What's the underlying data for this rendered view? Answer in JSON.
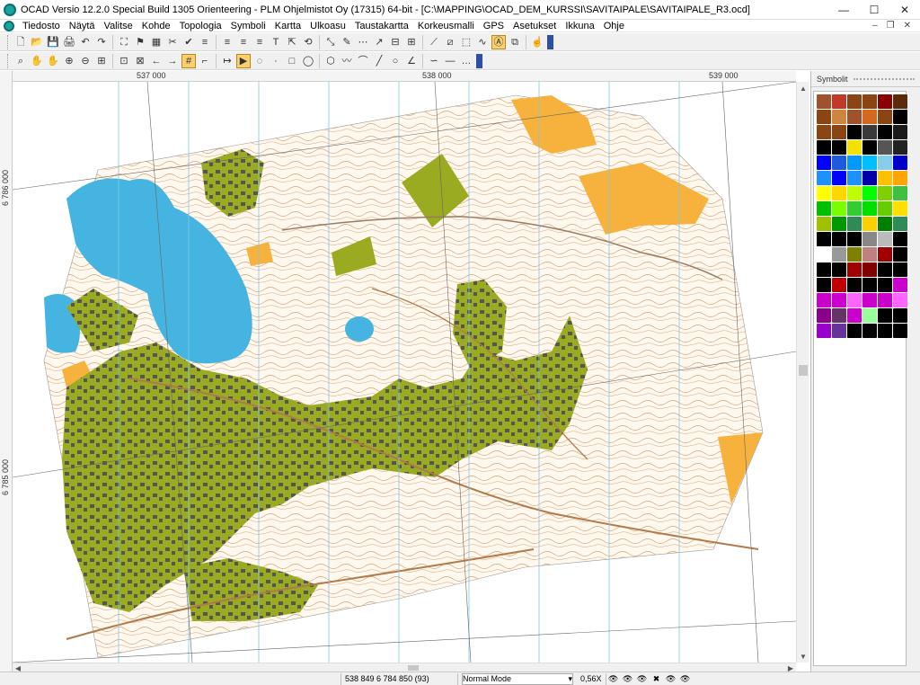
{
  "window": {
    "title": "OCAD Versio 12.2.0  Special Build 1305  Orienteering - PLM Ohjelmistot Oy (17315) 64-bit - [C:\\MAPPING\\OCAD_DEM_KURSSI\\SAVITAIPALE\\SAVITAIPALE_R3.ocd]",
    "minimize": "—",
    "maximize": "☐",
    "close": "✕"
  },
  "menu": {
    "items": [
      "Tiedosto",
      "Näytä",
      "Valitse",
      "Kohde",
      "Topologia",
      "Symboli",
      "Kartta",
      "Ulkoasu",
      "Taustakartta",
      "Korkeusmalli",
      "GPS",
      "Asetukset",
      "Ikkuna",
      "Ohje"
    ],
    "doc_min": "–",
    "doc_restore": "❐",
    "doc_close": "✕"
  },
  "toolbar1": {
    "icons": [
      "new-icon",
      "open-icon",
      "save-icon",
      "print-icon",
      "undo-icon",
      "redo-icon",
      "fit-icon",
      "help-icon",
      "color-icon",
      "cut-icon",
      "check-icon",
      "align-left-icon",
      "align-center-icon",
      "align-right-icon",
      "justify-icon",
      "text-icon",
      "move-icon",
      "rotate-icon",
      "scale-icon",
      "measure-icon",
      "reshape-icon",
      "edit-icon",
      "ruler-icon",
      "crop-icon",
      "cut-line-icon",
      "cut-area-icon",
      "merge-icon",
      "smooth-icon",
      "draw-mode-icon",
      "overlap-icon",
      "hand-icon"
    ],
    "glyphs": [
      "🗋",
      "📂",
      "💾",
      "🖨",
      "↶",
      "↷",
      "⛶",
      "⚑",
      "▦",
      "✂",
      "✔",
      "≡",
      "≡",
      "≡",
      "≡",
      "T",
      "⇱",
      "⟲",
      "⤡",
      "✎",
      "⋯",
      "↗",
      "⊟",
      "⊞",
      "⟋",
      "⧄",
      "⬚",
      "∿",
      "Ⓐ",
      "⧉",
      "☝"
    ]
  },
  "toolbar2": {
    "icons": [
      "binoculars-icon",
      "pan-icon",
      "hand-icon",
      "zoom-in-icon",
      "zoom-out-icon",
      "zoom-box-icon",
      "zoom-fit-icon",
      "zoom-page-icon",
      "back-icon",
      "forward-icon",
      "grid-icon",
      "snap-icon",
      "draw-arrow-icon",
      "select-icon",
      "lasso-icon",
      "point-icon",
      "rect-icon",
      "ellipse-icon",
      "polygon-icon",
      "freehand-icon",
      "curve-icon",
      "straight-icon",
      "circle-icon",
      "angle-icon",
      "spline-icon",
      "line-icon",
      "more-icon"
    ],
    "glyphs": [
      "⌕",
      "✋",
      "✋",
      "⊕",
      "⊖",
      "⊞",
      "⊡",
      "⊠",
      "←",
      "→",
      "#",
      "⌐",
      "↦",
      "▶",
      "◌",
      "·",
      "□",
      "◯",
      "⬡",
      "〰",
      "⌒",
      "╱",
      "○",
      "∠",
      "∽",
      "—",
      "…"
    ]
  },
  "rulers": {
    "top": [
      "537 000",
      "538 000",
      "539 000"
    ],
    "left": [
      "6 786 000",
      "6 785 000"
    ]
  },
  "symbols_panel": {
    "title": "Symbolit",
    "swatches": [
      "#a0522d",
      "#c0392b",
      "#8b4513",
      "#8b4513",
      "#8b0000",
      "#5a2a0a",
      "#8b4513",
      "#cd853f",
      "#a0522d",
      "#d2691e",
      "#8b4513",
      "#000000",
      "#8b4513",
      "#8b4513",
      "#000000",
      "#3a3a3a",
      "#000000",
      "#1a1a1a",
      "#000000",
      "#000000",
      "#f4e100",
      "#000000",
      "#555555",
      "#222222",
      "#0000ff",
      "#1e5adc",
      "#0099ff",
      "#00bfff",
      "#87ceeb",
      "#0000cd",
      "#1e90ff",
      "#0000ff",
      "#1e90ff",
      "#0000aa",
      "#ffc000",
      "#ffa500",
      "#ffff00",
      "#ffd700",
      "#c0ff00",
      "#00ff00",
      "#7fd000",
      "#40c040",
      "#00c000",
      "#7cfc00",
      "#33cc33",
      "#00e000",
      "#66cc00",
      "#ffe000",
      "#a0c000",
      "#009900",
      "#2e8b57",
      "#ffd000",
      "#008000",
      "#2e8b57",
      "#000000",
      "#000000",
      "#000000",
      "#888888",
      "#bbbbbb",
      "#000000",
      "#ffffff",
      "#999999",
      "#7f7f00",
      "#c08080",
      "#a00000",
      "#000000",
      "#000000",
      "#000000",
      "#a00000",
      "#800000",
      "#000000",
      "#000000",
      "#000000",
      "#c00000",
      "#000000",
      "#000000",
      "#000000",
      "#cc00cc",
      "#cc00cc",
      "#cc00cc",
      "#ff66ff",
      "#cc00cc",
      "#cc00cc",
      "#ff66ff",
      "#8b008b",
      "#663366",
      "#cc00cc",
      "#99ff99",
      "#000000",
      "#000000",
      "#9900cc",
      "#663399",
      "#000000",
      "#000000",
      "#000000",
      "#000000"
    ]
  },
  "status": {
    "coords": "538 849   6 784 850   (93)",
    "mode": "Normal Mode",
    "zoom": "0,56X",
    "layer_toggles": [
      "👁",
      "👁",
      "👁",
      "✖",
      "👁",
      "👁"
    ]
  }
}
